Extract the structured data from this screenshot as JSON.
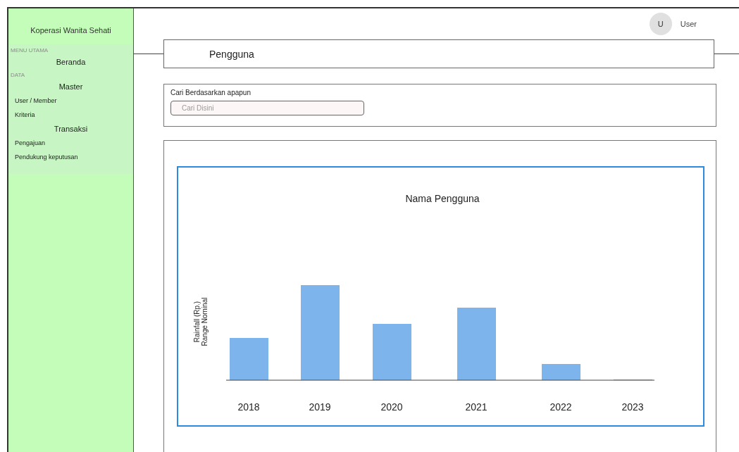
{
  "sidebar": {
    "title": "Koperasi Wanita Sehati",
    "items": [
      {
        "kind": "section",
        "label": "MENU UTAMA"
      },
      {
        "kind": "heading",
        "label": "Beranda"
      },
      {
        "kind": "section",
        "label": "DATA"
      },
      {
        "kind": "heading",
        "label": "Master"
      },
      {
        "kind": "link",
        "label": "User / Member"
      },
      {
        "kind": "link",
        "label": "Kriteria"
      },
      {
        "kind": "heading",
        "label": "Transaksi"
      },
      {
        "kind": "link",
        "label": "Pengajuan"
      },
      {
        "kind": "link",
        "label": "Pendukung keputusan"
      }
    ]
  },
  "user": {
    "initial": "U",
    "name": "User"
  },
  "page_title": "Pengguna",
  "search": {
    "label": "Cari Berdasarkan apapun",
    "placeholder": "Cari Disini"
  },
  "chart": {
    "title": "Nama Pengguna",
    "ylabel": [
      "Rainfall (Rp.)",
      "Range Nominal"
    ],
    "x_labels": [
      "2018",
      "2019",
      "2020",
      "2021",
      "2022",
      "2023"
    ]
  }
}
